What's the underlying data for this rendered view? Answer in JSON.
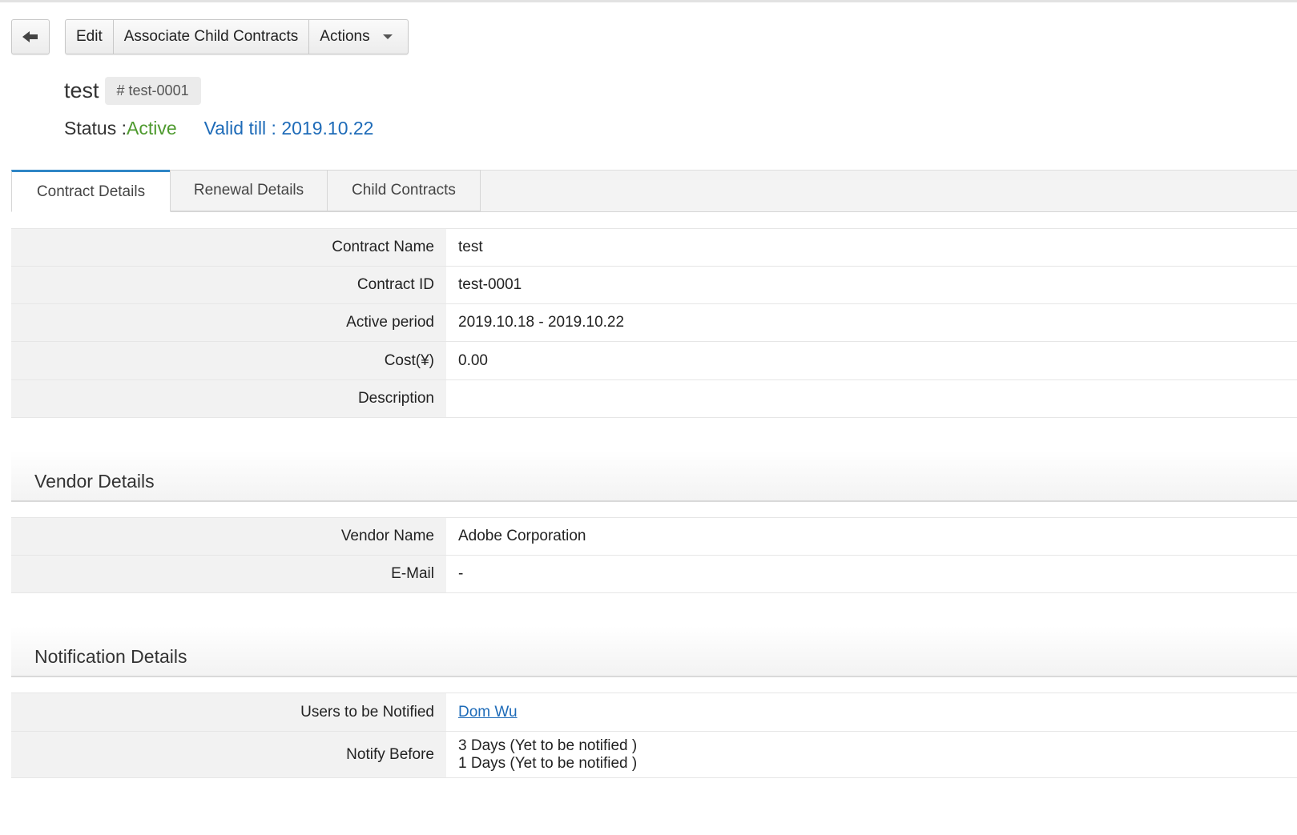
{
  "toolbar": {
    "edit_label": "Edit",
    "associate_label": "Associate Child Contracts",
    "actions_label": "Actions"
  },
  "header": {
    "title": "test",
    "id_badge": "# test-0001",
    "status_label": "Status : ",
    "status_value": "Active",
    "valid_till": "Valid till : 2019.10.22"
  },
  "tabs": [
    {
      "label": "Contract Details",
      "active": true
    },
    {
      "label": "Renewal Details",
      "active": false
    },
    {
      "label": "Child Contracts",
      "active": false
    }
  ],
  "contract_details": [
    {
      "label": "Contract Name",
      "value": "test"
    },
    {
      "label": "Contract ID",
      "value": "test-0001"
    },
    {
      "label": "Active period",
      "value": "2019.10.18 - 2019.10.22"
    },
    {
      "label": "Cost(¥)",
      "value": "0.00"
    },
    {
      "label": "Description",
      "value": ""
    }
  ],
  "vendor_section": {
    "title": "Vendor Details",
    "rows": [
      {
        "label": "Vendor Name",
        "value": "Adobe Corporation"
      },
      {
        "label": "E-Mail",
        "value": "-"
      }
    ]
  },
  "notification_section": {
    "title": "Notification Details",
    "users_label": "Users to be Notified",
    "users_value": "Dom Wu",
    "notify_label": "Notify Before",
    "notify_lines": [
      "3 Days (Yet to be notified )",
      "1 Days (Yet to be notified )"
    ]
  },
  "colors": {
    "status_active": "#4e9a2e",
    "link_blue": "#1e6bb8",
    "tab_accent": "#2f86c6"
  }
}
